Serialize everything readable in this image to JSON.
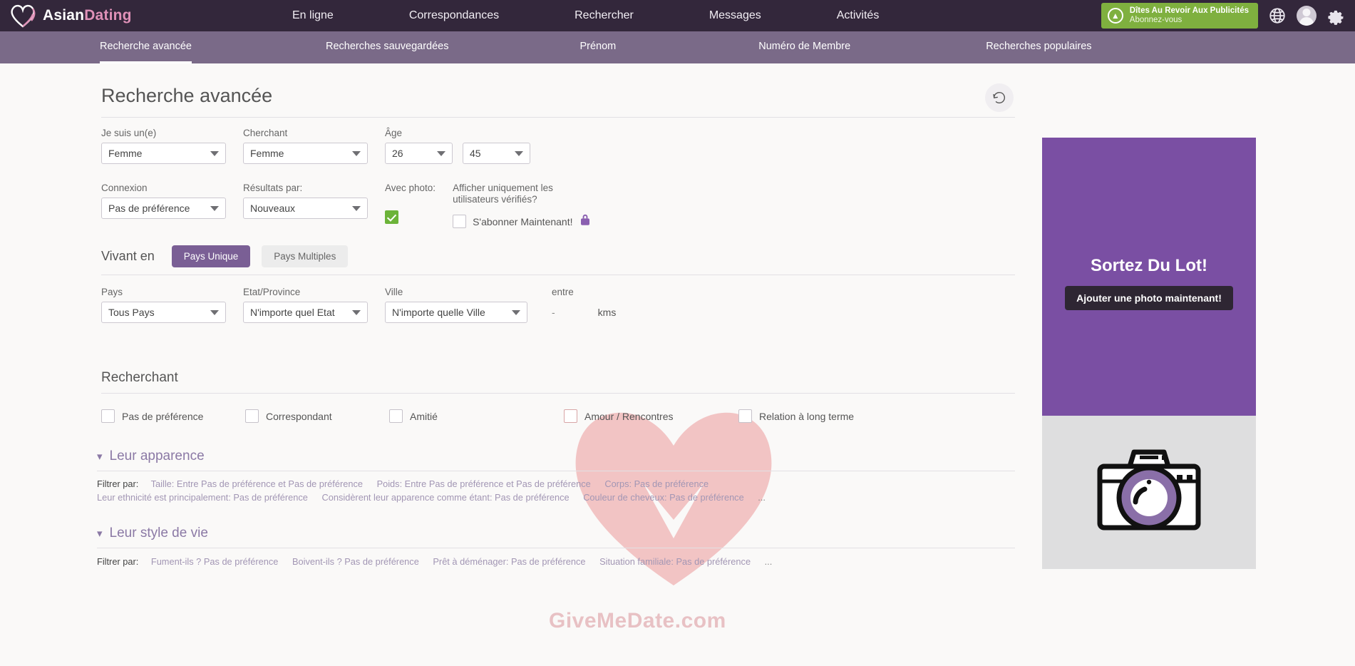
{
  "brand": {
    "name_part1": "Asian",
    "name_part2": "Dating",
    "logo_icon": "heart-icon"
  },
  "topnav": {
    "items": [
      {
        "label": "En ligne"
      },
      {
        "label": "Correspondances"
      },
      {
        "label": "Rechercher"
      },
      {
        "label": "Messages"
      },
      {
        "label": "Activités"
      }
    ],
    "cta": {
      "title": "Dîtes Au Revoir Aux Publicités",
      "subtitle": "Abonnez-vous",
      "icon": "arrow-up-circle-icon"
    },
    "icons": [
      "globe-icon",
      "avatar",
      "gear-icon"
    ]
  },
  "subnav": {
    "items": [
      {
        "label": "Recherche avancée",
        "active": true
      },
      {
        "label": "Recherches sauvegardées",
        "active": false
      },
      {
        "label": "Prénom",
        "active": false
      },
      {
        "label": "Numéro de Membre",
        "active": false
      },
      {
        "label": "Recherches populaires",
        "active": false
      }
    ]
  },
  "search": {
    "title": "Recherche avancée",
    "reset_icon": "reset-rotate-icon",
    "row1": {
      "i_am": {
        "label": "Je suis un(e)",
        "value": "Femme"
      },
      "seeking": {
        "label": "Cherchant",
        "value": "Femme"
      },
      "age": {
        "label": "Âge",
        "from": "26",
        "to": "45"
      }
    },
    "row2": {
      "connection": {
        "label": "Connexion",
        "value": "Pas de préférence"
      },
      "results_by": {
        "label": "Résultats par:",
        "value": "Nouveaux"
      },
      "with_photo": {
        "label": "Avec photo:",
        "checked": true
      },
      "verified": {
        "label_line1": "Afficher uniquement les",
        "label_line2": "utilisateurs vérifiés?",
        "checkbox_label": "S'abonner Maintenant!",
        "lock_icon": "padlock-icon",
        "checked": false
      }
    },
    "living_in": {
      "title": "Vivant en",
      "tab_single": "Pays Unique",
      "tab_multiple": "Pays Multiples",
      "active_tab": "Pays Unique",
      "country": {
        "label": "Pays",
        "value": "Tous Pays"
      },
      "state": {
        "label": "Etat/Province",
        "value": "N'importe quel Etat"
      },
      "city": {
        "label": "Ville",
        "value": "N'importe quelle Ville"
      },
      "distance": {
        "label": "entre",
        "dash": "-",
        "unit": "kms"
      }
    },
    "looking_for": {
      "title": "Recherchant",
      "options": [
        {
          "label": "Pas de préférence",
          "checked": false
        },
        {
          "label": "Correspondant",
          "checked": false
        },
        {
          "label": "Amitié",
          "checked": false
        },
        {
          "label": "Amour / Rencontres",
          "checked": false
        },
        {
          "label": "Relation à long terme",
          "checked": false
        }
      ]
    },
    "appearance": {
      "title": "Leur apparence",
      "chevron": "chevron-down-icon",
      "filter_label": "Filtrer par:",
      "line1": [
        "Taille: Entre Pas de préférence et Pas de préférence",
        "Poids: Entre Pas de préférence et Pas de préférence",
        "Corps: Pas de préférence"
      ],
      "line2": [
        "Leur ethnicité est principalement: Pas de préférence",
        "Considèrent leur apparence comme étant: Pas de préférence",
        "Couleur de cheveux: Pas de préférence"
      ],
      "more": "..."
    },
    "lifestyle": {
      "title": "Leur style de vie",
      "chevron": "chevron-down-icon",
      "filter_label": "Filtrer par:",
      "line1": [
        "Fument-ils ? Pas de préférence",
        "Boivent-ils ? Pas de préférence",
        "Prêt à déménager: Pas de préférence",
        "Situation familiale: Pas de préférence"
      ],
      "more": "..."
    }
  },
  "rail": {
    "promo": {
      "heading": "Sortez Du Lot!",
      "button": "Ajouter une photo maintenant!"
    },
    "photo_placeholder_icon": "camera-icon"
  },
  "watermark": {
    "text": "GiveMeDate.com",
    "icon": "heart-icon"
  },
  "colors": {
    "topbar": "#33273b",
    "subnav": "#7a6a88",
    "accent_purple": "#7a5f95",
    "ad_purple": "#7a4fa3",
    "green": "#7fb03f",
    "checkbox_green": "#6cb339"
  }
}
